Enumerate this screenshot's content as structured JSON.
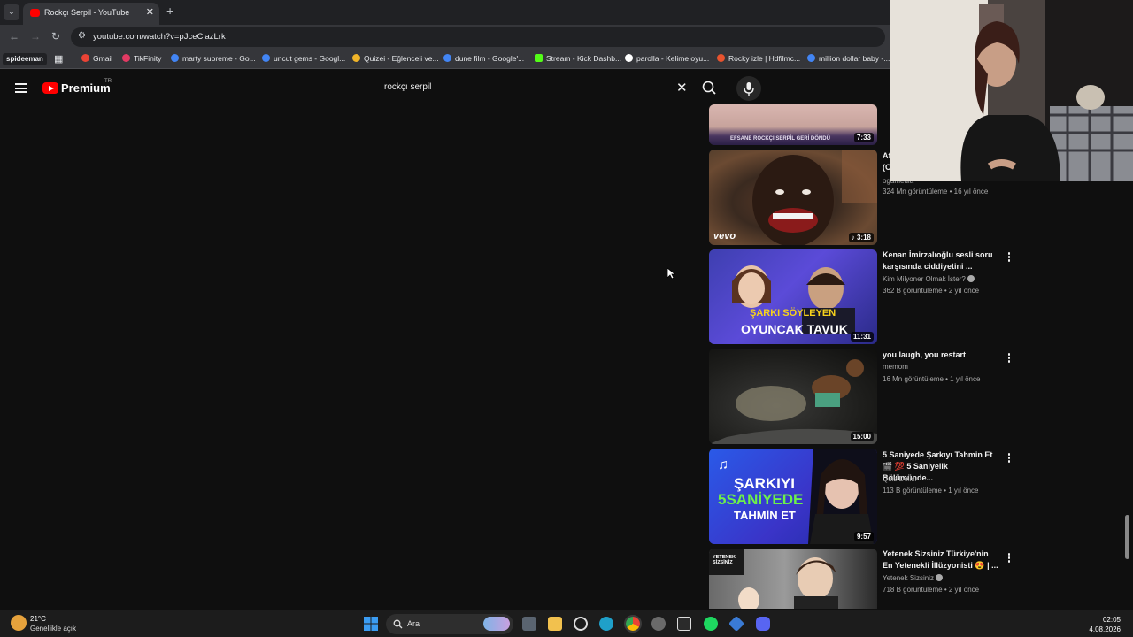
{
  "browser": {
    "tab_title": "Rockçı Serpil - YouTube",
    "url": "youtube.com/watch?v=pJceClazLrk",
    "profile": "spideeman",
    "bookmarks": [
      {
        "label": "Gmail",
        "color": "#ea4335"
      },
      {
        "label": "TikFinity",
        "color": "#e23a63"
      },
      {
        "label": "marty supreme - Go...",
        "color": "#4285f4"
      },
      {
        "label": "uncut gems - Googl...",
        "color": "#4285f4"
      },
      {
        "label": "Quizei - Eğlenceli ve...",
        "color": "#f0b429"
      },
      {
        "label": "dune film - Google'...",
        "color": "#4285f4"
      },
      {
        "label": "Stream - Kick Dashb...",
        "color": "#53fc18"
      },
      {
        "label": "parolla - Kelime oyu...",
        "color": "#ffffff"
      },
      {
        "label": "Rocky izle | Hdfilmc...",
        "color": "#e8532e"
      },
      {
        "label": "million dollar baby -...",
        "color": "#4285f4"
      }
    ]
  },
  "youtube": {
    "logo_text": "Premium",
    "region": "TR",
    "search_query": "rockçı serpil"
  },
  "related": [
    {
      "duration": "7:33",
      "title": "",
      "channel": "",
      "meta": "",
      "thumb_text": "EFSANE ROCKÇI SERPİL GERİ DÖNDÜ"
    },
    {
      "duration": "3:18",
      "title_line1": "Af",
      "title_line2": "(C",
      "channel": "ogamedia",
      "meta": "324 Mn görüntüleme • 16 yıl önce",
      "thumb_text": "vevo"
    },
    {
      "duration": "11:31",
      "title": "Kenan İmirzalıoğlu sesli soru karşısında ciddiyetini ...",
      "channel": "Kim Milyoner Olmak İster?",
      "meta": "362 B görüntüleme • 2 yıl önce",
      "thumb_line1": "ŞARKI SÖYLEYEN",
      "thumb_line2": "OYUNCAK TAVUK"
    },
    {
      "duration": "15:00",
      "title": "you laugh, you restart",
      "channel": "memom",
      "meta": "16 Mn görüntüleme • 1 yıl önce"
    },
    {
      "duration": "9:57",
      "title": "5 Saniyede Şarkıyı Tahmin Et 🎬 💯 5 Saniyelik Bölümünde...",
      "channel": "Quiz Delisi",
      "meta": "113 B görüntüleme • 1 yıl önce",
      "thumb_line1": "ŞARKIYI",
      "thumb_line2": "5SANİYEDE",
      "thumb_line3": "TAHMİN ET"
    },
    {
      "duration": "",
      "title": "Yetenek Sizsiniz Türkiye'nin En Yetenekli İllüzyonisti 😍 | ...",
      "channel": "Yetenek Sizsiniz",
      "meta": "718 B görüntüleme • 2 yıl önce",
      "thumb_text": "YETENEK SİZSİNİZ"
    }
  ],
  "taskbar": {
    "temperature": "21°C",
    "weather": "Genellikle açık",
    "search_label": "Ara",
    "time": "02:05",
    "date": "4.08.2026"
  }
}
